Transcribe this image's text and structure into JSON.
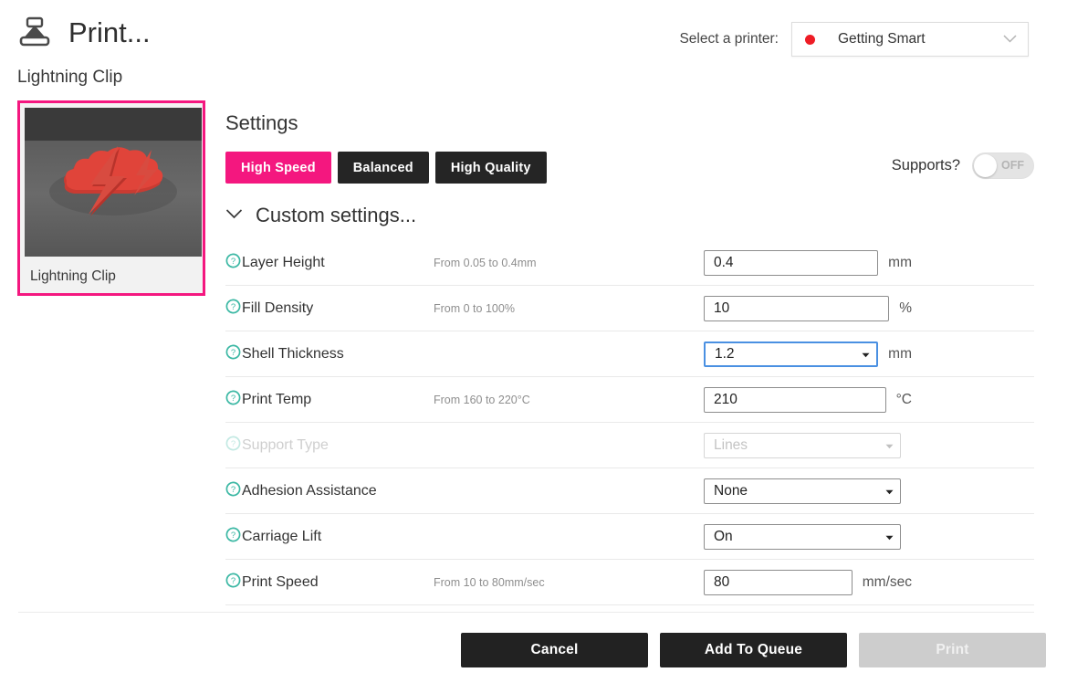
{
  "header": {
    "icon": "printer-extruder-icon",
    "title": "Print...",
    "subtitle": "Lightning Clip",
    "printer_select_label": "Select a printer:",
    "printer_name": "Getting Smart",
    "printer_status_color": "#ee1c25",
    "chevron_icon": "chevron-down-icon"
  },
  "model_card": {
    "caption": "Lightning Clip",
    "selected_border_color": "#f4177f"
  },
  "settings": {
    "heading": "Settings",
    "presets": [
      {
        "label": "High Speed",
        "active": true
      },
      {
        "label": "Balanced",
        "active": false
      },
      {
        "label": "High Quality",
        "active": false
      }
    ],
    "accent_color": "#f4177f",
    "custom_toggle": {
      "label": "Custom settings...",
      "chevron_icon": "chevron-down-icon",
      "expanded": true
    },
    "supports": {
      "label": "Supports?",
      "toggle_state": "OFF"
    },
    "help_icon": "question-circle-icon",
    "help_icon_color": "#3cb8a4",
    "rows": [
      {
        "label": "Layer Height",
        "hint": "From 0.05 to 0.4mm",
        "value": "0.4",
        "unit": "mm",
        "type": "text",
        "disabled": false,
        "focused": false
      },
      {
        "label": "Fill Density",
        "hint": "From 0 to 100%",
        "value": "10",
        "unit": "%",
        "type": "text",
        "disabled": false,
        "focused": false
      },
      {
        "label": "Shell Thickness",
        "hint": "",
        "value": "1.2",
        "unit": "mm",
        "type": "select",
        "disabled": false,
        "focused": true
      },
      {
        "label": "Print Temp",
        "hint": "From 160 to 220°C",
        "value": "210",
        "unit": "°C",
        "type": "text",
        "disabled": false,
        "focused": false
      },
      {
        "label": "Support Type",
        "hint": "",
        "value": "Lines",
        "unit": "",
        "type": "select",
        "disabled": true,
        "focused": false
      },
      {
        "label": "Adhesion Assistance",
        "hint": "",
        "value": "None",
        "unit": "",
        "type": "select",
        "disabled": false,
        "focused": false
      },
      {
        "label": "Carriage Lift",
        "hint": "",
        "value": "On",
        "unit": "",
        "type": "select",
        "disabled": false,
        "focused": false
      },
      {
        "label": "Print Speed",
        "hint": "From 10 to 80mm/sec",
        "value": "80",
        "unit": "mm/sec",
        "type": "text",
        "disabled": false,
        "focused": false
      }
    ]
  },
  "footer": {
    "buttons": [
      {
        "label": "Cancel",
        "disabled": false
      },
      {
        "label": "Add To Queue",
        "disabled": false
      },
      {
        "label": "Print",
        "disabled": true
      }
    ]
  }
}
